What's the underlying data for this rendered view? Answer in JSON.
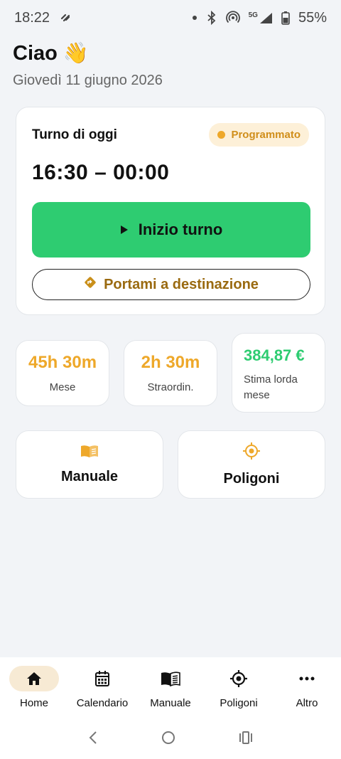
{
  "status_bar": {
    "time": "18:22",
    "network": "5G",
    "battery": "55%"
  },
  "greeting": {
    "title": "Ciao",
    "emoji": "👋",
    "date": "Giovedì 11 giugno 2026"
  },
  "shift": {
    "title": "Turno di oggi",
    "status": "Programmato",
    "time": "16:30 – 00:00",
    "start_label": "Inizio turno",
    "navigate_label": "Portami a destinazione"
  },
  "stats": {
    "month_hours": {
      "value": "45h 30m",
      "label": "Mese"
    },
    "overtime": {
      "value": "2h 30m",
      "label": "Straordin."
    },
    "earnings": {
      "value": "384,87 €",
      "label": "Stima lorda mese"
    }
  },
  "tiles": {
    "manual": {
      "label": "Manuale",
      "icon": "book-icon"
    },
    "polygons": {
      "label": "Poligoni",
      "icon": "target-icon"
    }
  },
  "bottom_nav": {
    "items": [
      {
        "label": "Home",
        "icon": "home-icon",
        "active": true
      },
      {
        "label": "Calendario",
        "icon": "calendar-icon",
        "active": false
      },
      {
        "label": "Manuale",
        "icon": "book-icon",
        "active": false
      },
      {
        "label": "Poligoni",
        "icon": "target-icon",
        "active": false
      },
      {
        "label": "Altro",
        "icon": "more-icon",
        "active": false
      }
    ]
  },
  "colors": {
    "accent": "#eea82a",
    "success": "#2ecc71",
    "background": "#f2f4f7"
  }
}
